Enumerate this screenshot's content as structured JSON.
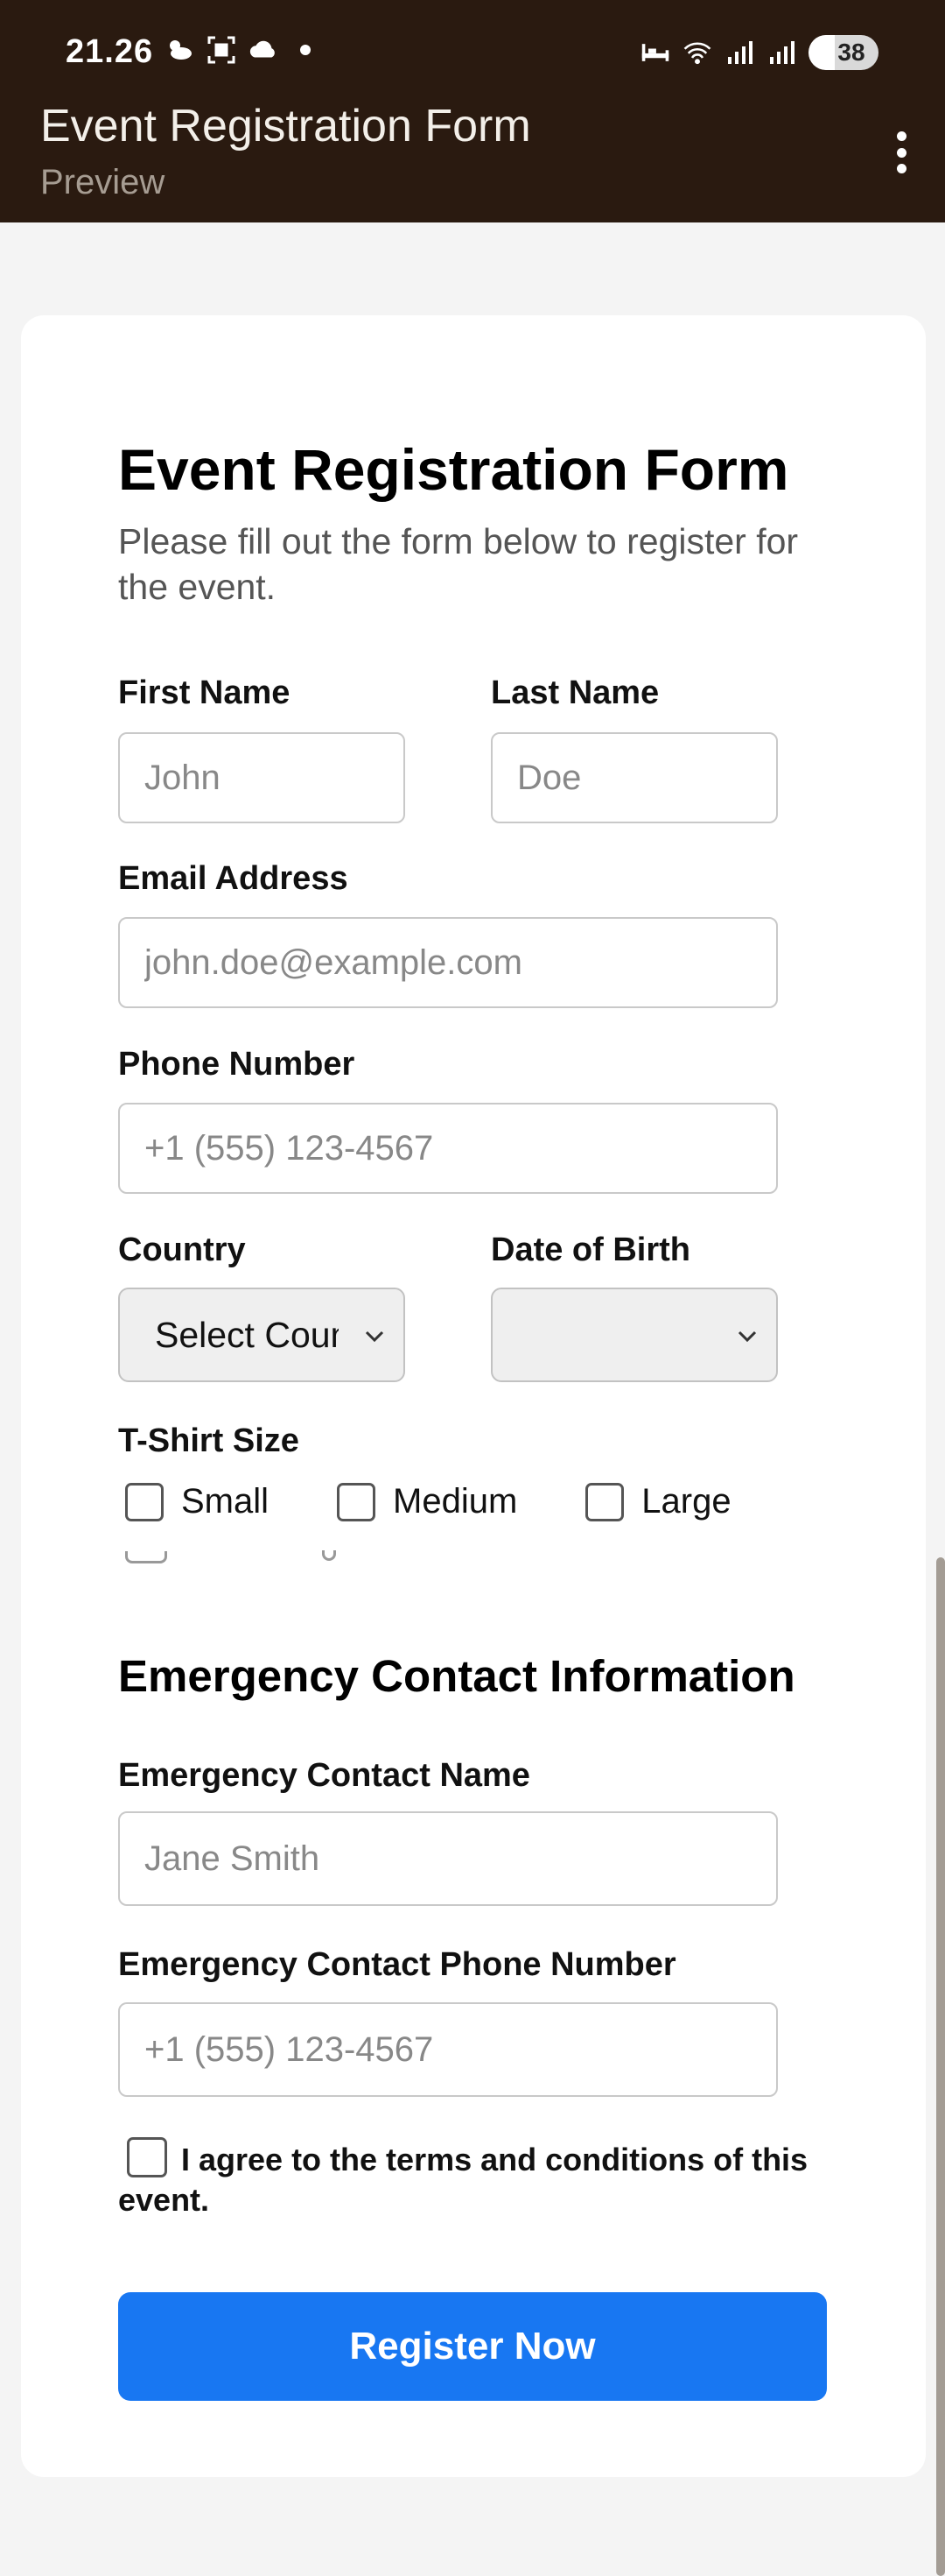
{
  "status_bar": {
    "time": "21.26",
    "battery": "38",
    "icons_left": [
      "weather-icon",
      "screenshot-icon",
      "cloud-icon",
      "dot-icon"
    ],
    "icons_right": [
      "bed-icon",
      "wifi-icon",
      "signal-icon",
      "signal-icon"
    ]
  },
  "app_bar": {
    "title": "Event Registration Form",
    "subtitle": "Preview"
  },
  "form": {
    "title": "Event Registration Form",
    "description": "Please fill out the form below to register for the event.",
    "first_name": {
      "label": "First Name",
      "placeholder": "John"
    },
    "last_name": {
      "label": "Last Name",
      "placeholder": "Doe"
    },
    "email": {
      "label": "Email Address",
      "placeholder": "john.doe@example.com"
    },
    "phone": {
      "label": "Phone Number",
      "placeholder": "+1 (555) 123-4567"
    },
    "country": {
      "label": "Country",
      "value": "Select Country"
    },
    "dob": {
      "label": "Date of Birth",
      "value": ""
    },
    "tshirt": {
      "label": "T-Shirt Size",
      "options": [
        "Small",
        "Medium",
        "Large"
      ]
    },
    "emergency": {
      "section_title": "Emergency Contact Information",
      "name": {
        "label": "Emergency Contact Name",
        "placeholder": "Jane Smith"
      },
      "phone": {
        "label": "Emergency Contact Phone Number",
        "placeholder": "+1 (555) 123-4567"
      }
    },
    "terms_label": "I agree to the terms and conditions of this event.",
    "submit_label": "Register Now"
  },
  "colors": {
    "app_bar": "#2a1a10",
    "primary_button": "#1877f2"
  }
}
